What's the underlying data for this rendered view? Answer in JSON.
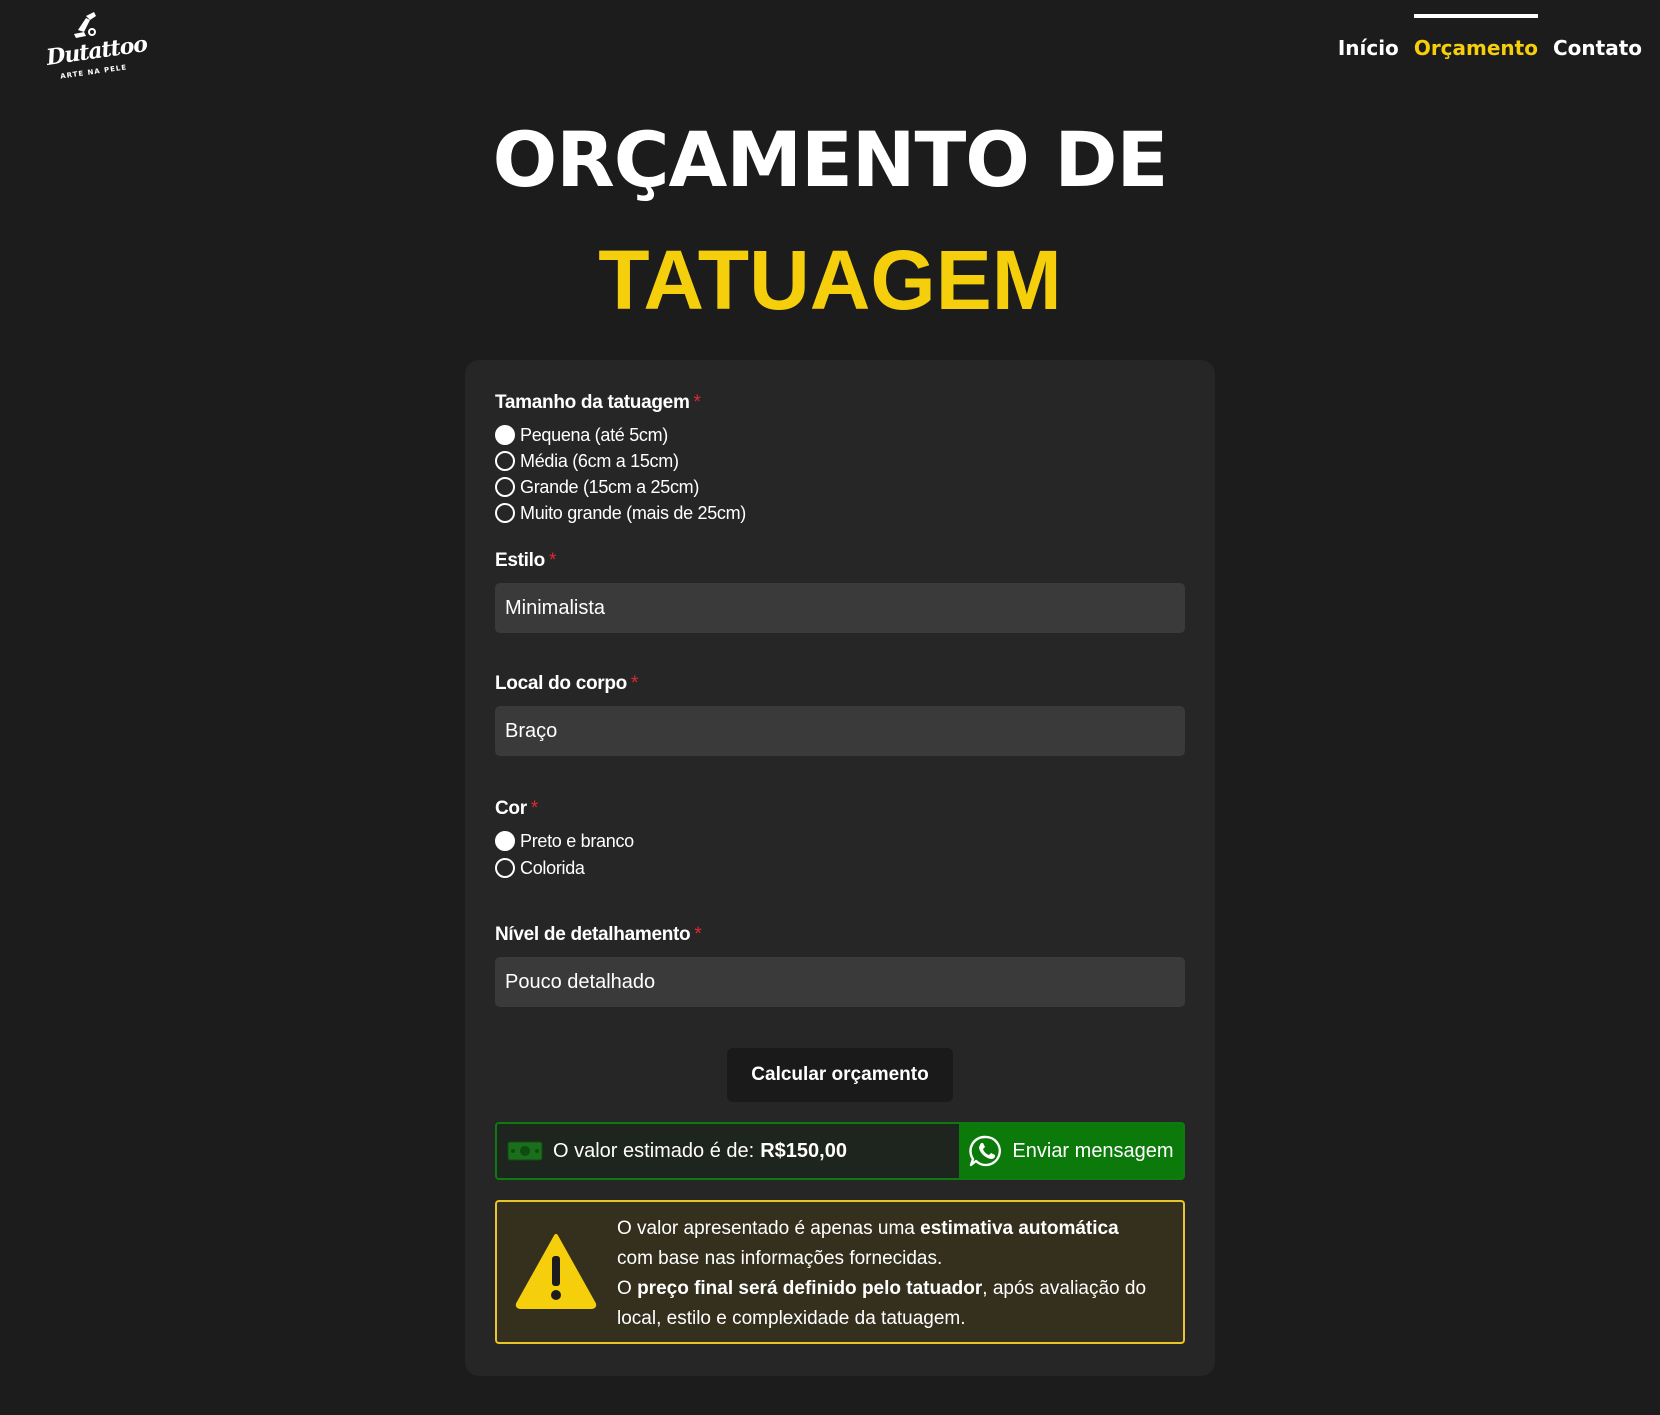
{
  "header": {
    "logo": {
      "name": "Dutattoo",
      "tagline": "ARTE NA PELE"
    },
    "nav": [
      {
        "label": "Início",
        "active": false
      },
      {
        "label": "Orçamento",
        "active": true
      },
      {
        "label": "Contato",
        "active": false
      }
    ]
  },
  "title": {
    "line1": "ORÇAMENTO DE",
    "line2": "TATUAGEM"
  },
  "form": {
    "size": {
      "label": "Tamanho da tatuagem",
      "required_mark": "*",
      "options": [
        {
          "label": "Pequena (até 5cm)",
          "checked": true
        },
        {
          "label": "Média (6cm a 15cm)",
          "checked": false
        },
        {
          "label": "Grande (15cm a 25cm)",
          "checked": false
        },
        {
          "label": "Muito grande (mais de 25cm)",
          "checked": false
        }
      ]
    },
    "style": {
      "label": "Estilo",
      "required_mark": "*",
      "value": "Minimalista"
    },
    "body_location": {
      "label": "Local do corpo",
      "required_mark": "*",
      "value": "Braço"
    },
    "color": {
      "label": "Cor",
      "required_mark": "*",
      "options": [
        {
          "label": "Preto e branco",
          "checked": true
        },
        {
          "label": "Colorida",
          "checked": false
        }
      ]
    },
    "detail": {
      "label": "Nível de detalhamento",
      "required_mark": "*",
      "value": "Pouco detalhado"
    },
    "calculate_label": "Calcular orçamento"
  },
  "result": {
    "icon": "money-icon",
    "text": "O valor estimado é de:",
    "value": "R$150,00",
    "whatsapp_label": "Enviar mensagem",
    "whatsapp_icon": "whatsapp-icon"
  },
  "warning": {
    "icon": "warning-icon",
    "p1_prefix": "O valor apresentado é apenas uma ",
    "p1_bold": "estimativa automática",
    "p1_suffix": "com base nas informações fornecidas.",
    "p2_prefix": "O ",
    "p2_bold": "preço final será definido pelo tatuador",
    "p2_suffix": ", após avaliação do local, estilo e complexidade da tatuagem."
  },
  "colors": {
    "background": "#1c1c1c",
    "card": "#262626",
    "accent_yellow": "#f5cf0c",
    "required_red": "#e0282f",
    "whatsapp_green": "#0b7a0b",
    "warning_border": "#e8c52a"
  }
}
